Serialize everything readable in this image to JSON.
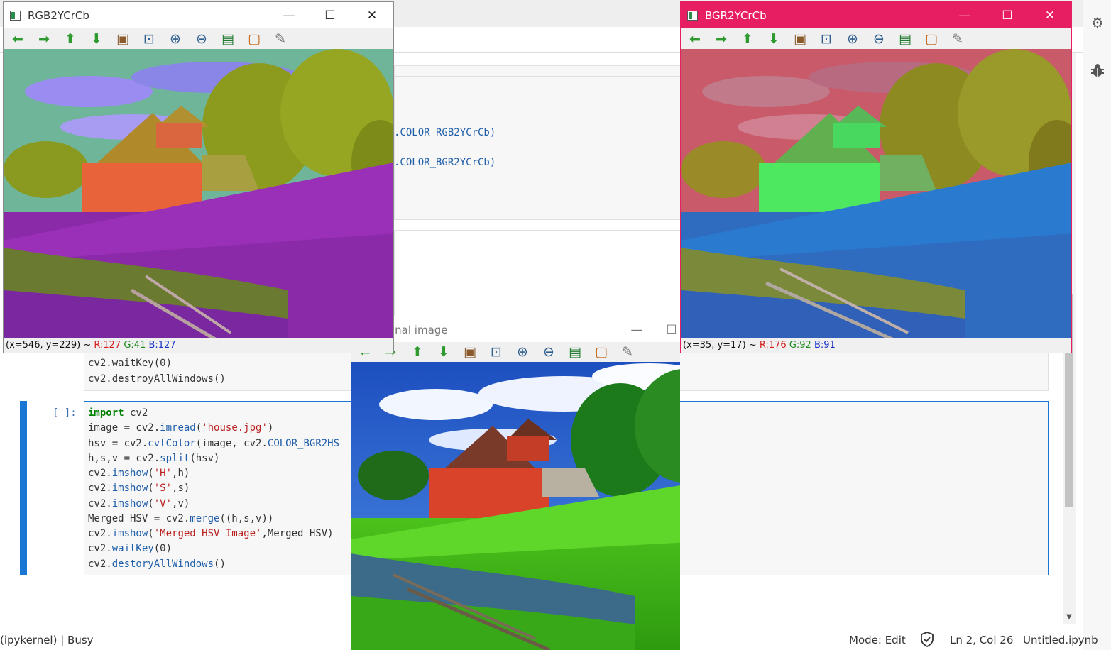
{
  "notebook": {
    "code_fragments": [
      ".COLOR_RGB2YCrCb)",
      ".COLOR_BGR2YCrCb)"
    ],
    "prev_cell_lines": [
      "cv2.waitKey(0)",
      "cv2.destroyAllWindows()"
    ],
    "prompt": "[ ]:",
    "active_cell": {
      "l1_kw": "import",
      "l1_rest": " cv2",
      "l2_a": "image = cv2.",
      "l2_fn": "imread",
      "l2_b": "(",
      "l2_str": "'house.jpg'",
      "l2_c": ")",
      "l3_a": "hsv = cv2.",
      "l3_fn": "cvtColor",
      "l3_b": "(image, cv2.",
      "l3_fn2": "COLOR_BGR2HS",
      "l4_a": "h,s,v = cv2.",
      "l4_fn": "split",
      "l4_b": "(hsv)",
      "l5_a": "cv2.",
      "l5_fn": "imshow",
      "l5_b": "(",
      "l5_str": "'H'",
      "l5_c": ",h)",
      "l6_a": "cv2.",
      "l6_fn": "imshow",
      "l6_b": "(",
      "l6_str": "'S'",
      "l6_c": ",s)",
      "l7_a": "cv2.",
      "l7_fn": "imshow",
      "l7_b": "(",
      "l7_str": "'V'",
      "l7_c": ",v)",
      "l8_a": "Merged_HSV = cv2.",
      "l8_fn": "merge",
      "l8_b": "((h,s,v))",
      "l9_a": "cv2.",
      "l9_fn": "imshow",
      "l9_b": "(",
      "l9_str": "'Merged HSV Image'",
      "l9_c": ",Merged_HSV)",
      "l10_a": "cv2.",
      "l10_fn": "waitKey",
      "l10_b": "(0)",
      "l11_a": "cv2.",
      "l11_fn": "destoryAllWindows",
      "l11_b": "()"
    }
  },
  "statusbar": {
    "kernel": "(ipykernel) | Busy",
    "mode": "Mode: Edit",
    "position": "Ln 2, Col 26",
    "filename": "Untitled.ipynb"
  },
  "windows": {
    "rgb": {
      "title": "RGB2YCrCb",
      "status_coords": "(x=546, y=229) ~",
      "r": "R:127",
      "g": "G:41",
      "b": "B:127"
    },
    "bgr": {
      "title": "BGR2YCrCb",
      "status_coords": "(x=35, y=17) ~",
      "r": "R:176",
      "g": "G:92",
      "b": "B:91",
      "active_color": "#e81e63"
    },
    "original": {
      "title": "inal image"
    }
  },
  "window_buttons": {
    "minimize": "—",
    "maximize": "☐",
    "close": "✕"
  },
  "toolbar_icons": [
    "arrow-left-icon",
    "arrow-right-icon",
    "arrow-up-icon",
    "arrow-down-icon",
    "zoom-original-icon",
    "zoom-fit-icon",
    "zoom-in-icon",
    "zoom-out-icon",
    "save-icon",
    "copy-clipboard-icon",
    "properties-brush-icon"
  ]
}
